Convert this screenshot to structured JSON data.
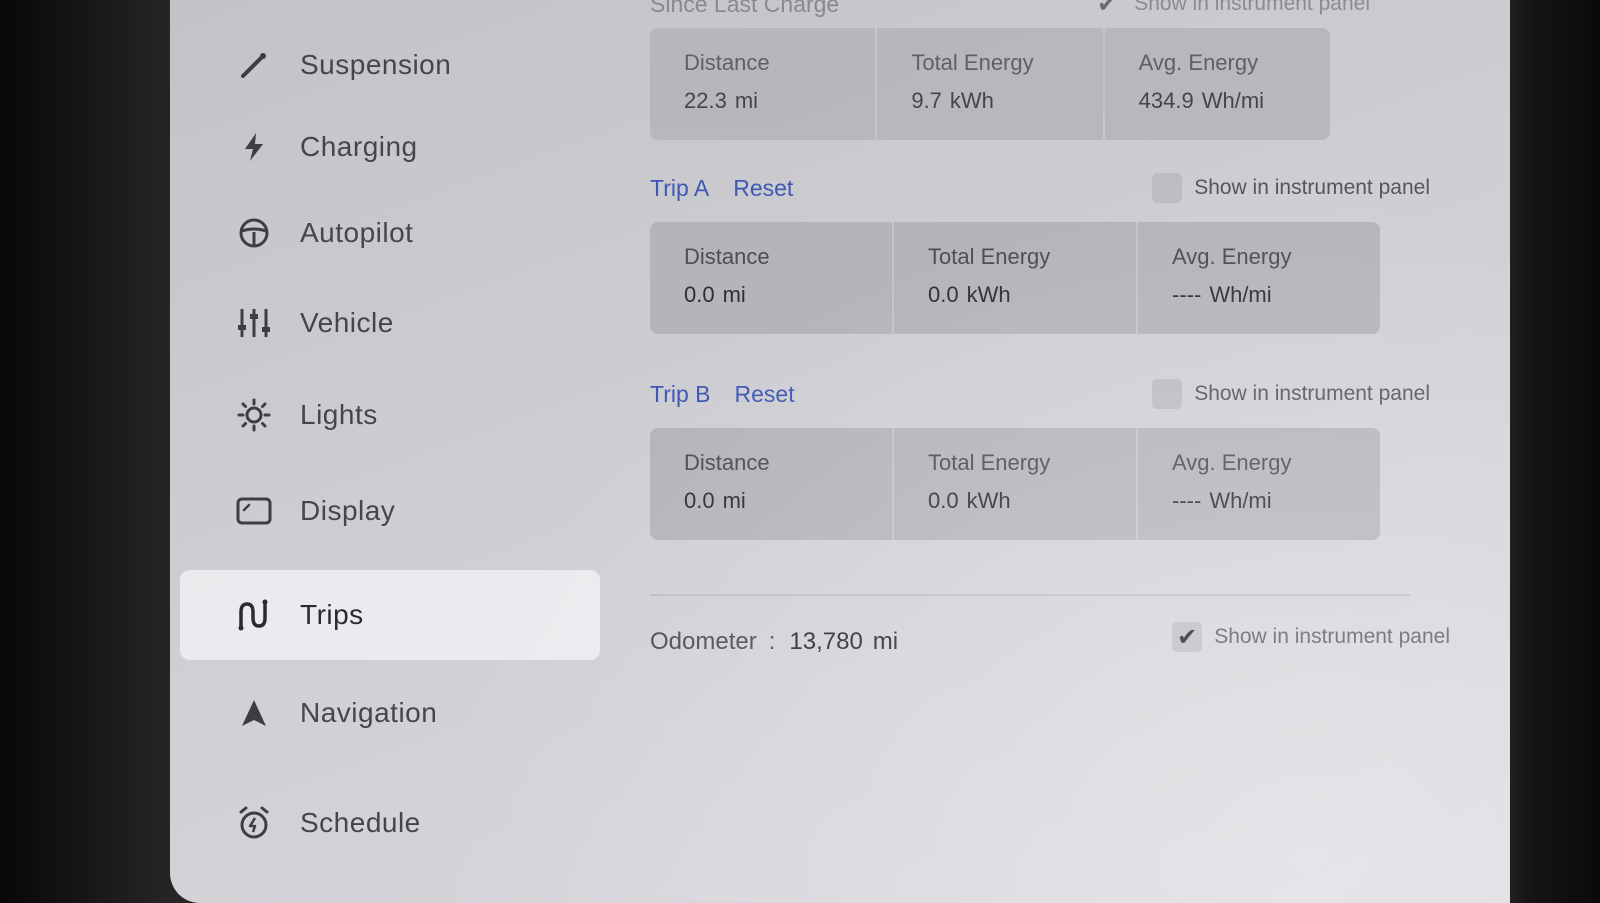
{
  "sidebar": {
    "items": [
      {
        "label": "Suspension",
        "icon": "suspension-icon"
      },
      {
        "label": "Charging",
        "icon": "bolt-icon"
      },
      {
        "label": "Autopilot",
        "icon": "steering-wheel-icon"
      },
      {
        "label": "Vehicle",
        "icon": "sliders-icon"
      },
      {
        "label": "Lights",
        "icon": "sun-icon"
      },
      {
        "label": "Display",
        "icon": "display-icon"
      },
      {
        "label": "Trips",
        "icon": "trips-icon",
        "active": true
      },
      {
        "label": "Navigation",
        "icon": "navigation-arrow-icon"
      },
      {
        "label": "Schedule",
        "icon": "alarm-clock-icon"
      }
    ]
  },
  "since_last_charge": {
    "title": "Since Last Charge",
    "show_in_panel_label": "Show in instrument panel",
    "show_in_panel_checked": true,
    "distance_label": "Distance",
    "distance_value": "22.3",
    "distance_unit": "mi",
    "energy_label": "Total Energy",
    "energy_value": "9.7",
    "energy_unit": "kWh",
    "avg_label": "Avg. Energy",
    "avg_value": "434.9",
    "avg_unit": "Wh/mi"
  },
  "trip_a": {
    "title": "Trip A",
    "reset_label": "Reset",
    "show_in_panel_label": "Show in instrument panel",
    "show_in_panel_checked": false,
    "distance_label": "Distance",
    "distance_value": "0.0",
    "distance_unit": "mi",
    "energy_label": "Total Energy",
    "energy_value": "0.0",
    "energy_unit": "kWh",
    "avg_label": "Avg. Energy",
    "avg_value": "----",
    "avg_unit": "Wh/mi"
  },
  "trip_b": {
    "title": "Trip B",
    "reset_label": "Reset",
    "show_in_panel_label": "Show in instrument panel",
    "show_in_panel_checked": false,
    "distance_label": "Distance",
    "distance_value": "0.0",
    "distance_unit": "mi",
    "energy_label": "Total Energy",
    "energy_value": "0.0",
    "energy_unit": "kWh",
    "avg_label": "Avg. Energy",
    "avg_value": "----",
    "avg_unit": "Wh/mi"
  },
  "odometer": {
    "label": "Odometer",
    "separator": ":",
    "value": "13,780",
    "unit": "mi",
    "show_in_panel_label": "Show in instrument panel",
    "show_in_panel_checked": true
  },
  "colors": {
    "accent": "#3e59b5",
    "screen_bg": "#cfced3",
    "card_bg": "#b4b4ba"
  }
}
